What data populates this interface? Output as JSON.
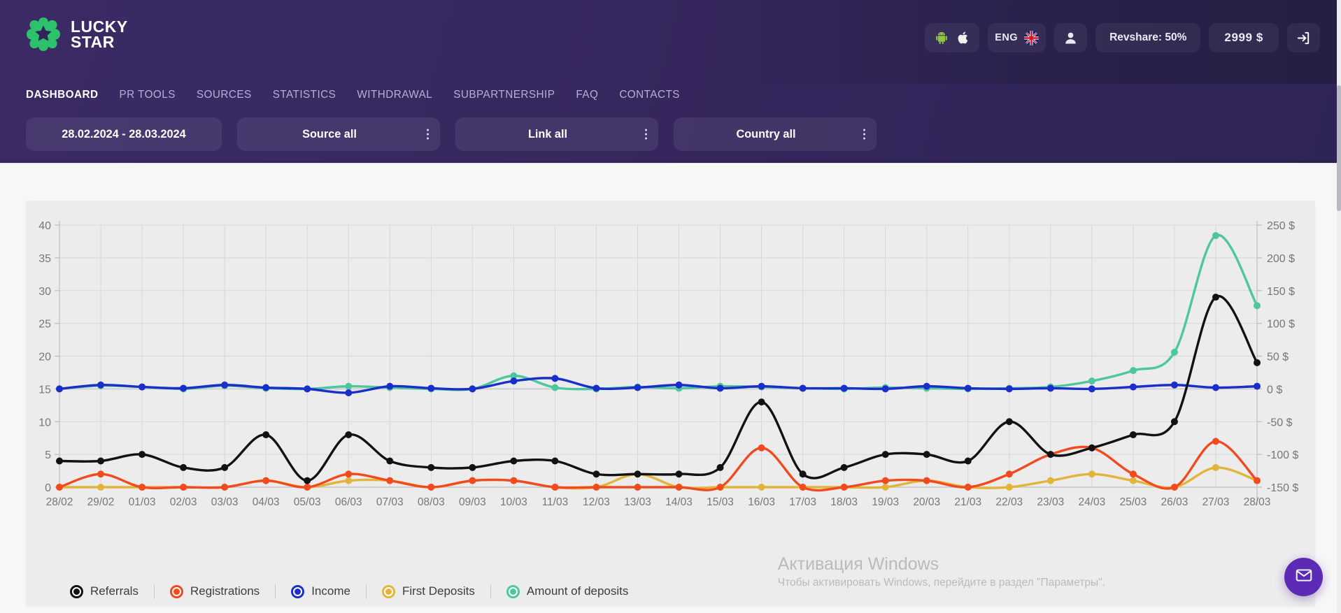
{
  "brand": {
    "line1": "LUCKY",
    "line2": "STAR",
    "logo_color": "#2ec16b",
    "accent": "#5b2bb5"
  },
  "header": {
    "os_pill": {
      "android_icon": "android-icon",
      "apple_icon": "apple-icon"
    },
    "language": {
      "code": "ENG",
      "flag_icon": "uk-flag-icon"
    },
    "user_icon": "user-avatar-icon",
    "revshare": "Revshare: 50%",
    "balance": "2999  $",
    "logout_icon": "logout-icon"
  },
  "nav": {
    "items": [
      {
        "label": "DASHBOARD",
        "active": true
      },
      {
        "label": "PR TOOLS",
        "active": false
      },
      {
        "label": "SOURCES",
        "active": false
      },
      {
        "label": "STATISTICS",
        "active": false
      },
      {
        "label": "WITHDRAWAL",
        "active": false
      },
      {
        "label": "SUBPARTNERSHIP",
        "active": false
      },
      {
        "label": "FAQ",
        "active": false
      },
      {
        "label": "CONTACTS",
        "active": false
      }
    ]
  },
  "filters": {
    "date_range": "28.02.2024 - 28.03.2024",
    "source": "Source all",
    "link": "Link all",
    "country": "Country all"
  },
  "watermark": {
    "title": "Активация Windows",
    "subtitle": "Чтобы активировать Windows, перейдите в раздел \"Параметры\"."
  },
  "chat": {
    "icon": "envelope-icon"
  },
  "chart_data": {
    "type": "line",
    "title": "",
    "xlabel": "",
    "ylabel": "",
    "grid": true,
    "legend_position": "bottom",
    "x": [
      "28/02",
      "29/02",
      "01/03",
      "02/03",
      "03/03",
      "04/03",
      "05/03",
      "06/03",
      "07/03",
      "08/03",
      "09/03",
      "10/03",
      "11/03",
      "12/03",
      "13/03",
      "14/03",
      "15/03",
      "16/03",
      "17/03",
      "18/03",
      "19/03",
      "20/03",
      "21/03",
      "22/03",
      "23/03",
      "24/03",
      "25/03",
      "26/03",
      "27/03",
      "28/03"
    ],
    "left_axis": {
      "label": "",
      "ticks": [
        0,
        5,
        10,
        15,
        20,
        25,
        30,
        35,
        40
      ],
      "ylim": [
        0,
        40
      ]
    },
    "right_axis": {
      "label": "$",
      "ticks": [
        "-150 $",
        "-100 $",
        "-50 $",
        "0 $",
        "50 $",
        "100 $",
        "150 $",
        "200 $",
        "250 $"
      ],
      "ylim": [
        -150,
        250
      ]
    },
    "series": [
      {
        "name": "Referrals",
        "color": "#121212",
        "axis": "left",
        "values": [
          4,
          4,
          5,
          3,
          3,
          8,
          1,
          8,
          4,
          3,
          3,
          4,
          4,
          2,
          2,
          2,
          3,
          13,
          2,
          3,
          5,
          5,
          4,
          10,
          5,
          6,
          8,
          10,
          29,
          19
        ]
      },
      {
        "name": "Registrations",
        "color": "#f04a1e",
        "axis": "left",
        "values": [
          0,
          2,
          0,
          0,
          0,
          1,
          0,
          2,
          1,
          0,
          1,
          1,
          0,
          0,
          0,
          0,
          0,
          6,
          0,
          0,
          1,
          1,
          0,
          2,
          5,
          6,
          2,
          0,
          7,
          1
        ]
      },
      {
        "name": "Income",
        "color": "#1a2ec9",
        "axis": "right",
        "values": [
          0,
          6,
          3,
          1,
          6,
          2,
          0,
          -6,
          4,
          1,
          0,
          12,
          16,
          1,
          2,
          6,
          1,
          4,
          1,
          1,
          0,
          4,
          1,
          0,
          1,
          0,
          3,
          6,
          2,
          4
        ]
      },
      {
        "name": "First Deposits",
        "color": "#e2b53a",
        "axis": "left",
        "values": [
          0,
          0,
          0,
          0,
          0,
          1,
          0,
          1,
          1,
          0,
          1,
          1,
          0,
          0,
          2,
          0,
          0,
          0,
          0,
          0,
          0,
          1,
          0,
          0,
          1,
          2,
          1,
          0,
          3,
          1
        ]
      },
      {
        "name": "Amount of deposits",
        "color": "#4ec79e",
        "axis": "right",
        "values": [
          0,
          5,
          3,
          0,
          5,
          1,
          0,
          4,
          2,
          0,
          0,
          20,
          2,
          0,
          3,
          1,
          4,
          3,
          1,
          0,
          2,
          1,
          0,
          1,
          3,
          12,
          28,
          56,
          234,
          127
        ]
      }
    ],
    "legend": [
      {
        "label": "Referrals",
        "color": "#121212"
      },
      {
        "label": "Registrations",
        "color": "#f04a1e"
      },
      {
        "label": "Income",
        "color": "#1a2ec9"
      },
      {
        "label": "First Deposits",
        "color": "#e2b53a"
      },
      {
        "label": "Amount of deposits",
        "color": "#4ec79e"
      }
    ]
  }
}
